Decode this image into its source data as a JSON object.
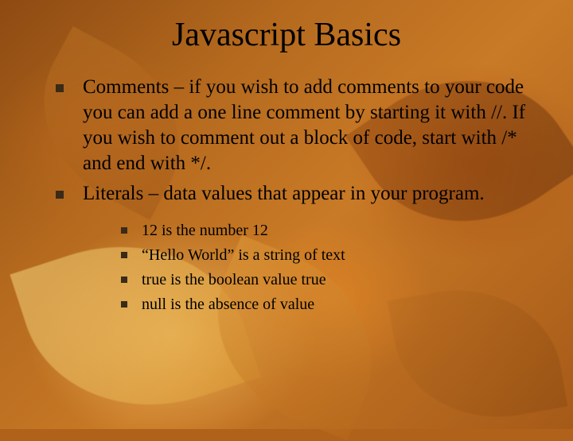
{
  "title": "Javascript Basics",
  "bullets": {
    "b1": "Comments – if you wish to add comments to your code you can add a one line comment by starting it with //. If you wish to comment out a block of code, start with /* and end with */.",
    "b2": "Literals – data values that appear in your program."
  },
  "subbullets": {
    "s1": "12 is the number 12",
    "s2": "“Hello World” is a string of text",
    "s3": "true is the boolean value true",
    "s4": "null is the absence of value"
  }
}
